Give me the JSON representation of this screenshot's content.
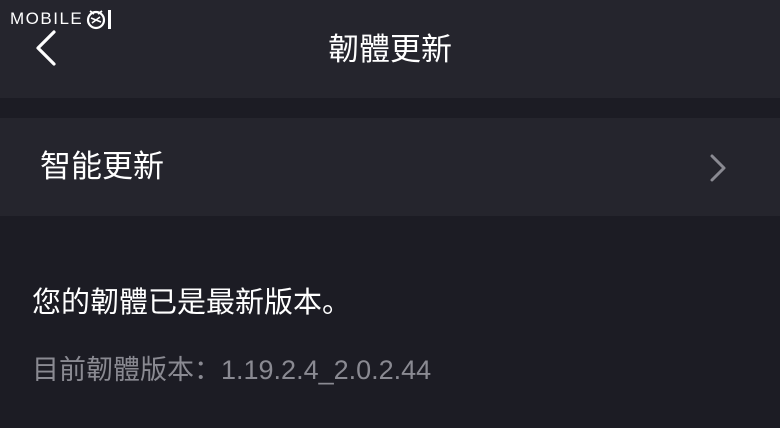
{
  "watermark": {
    "text": "MOBILE"
  },
  "header": {
    "title": "韌體更新"
  },
  "settings": {
    "smart_update_label": "智能更新"
  },
  "status": {
    "message": "您的韌體已是最新版本。",
    "version_line": "目前韌體版本：1.19.2.4_2.0.2.44"
  },
  "colors": {
    "background": "#1c1c24",
    "surface": "#25252d",
    "text_primary": "#ffffff",
    "text_secondary": "#8a8a92",
    "chevron": "#8a8a92"
  },
  "icons": {
    "back": "chevron-left-icon",
    "row": "chevron-right-icon",
    "watermark_logo": "mobile01-logo-icon"
  }
}
